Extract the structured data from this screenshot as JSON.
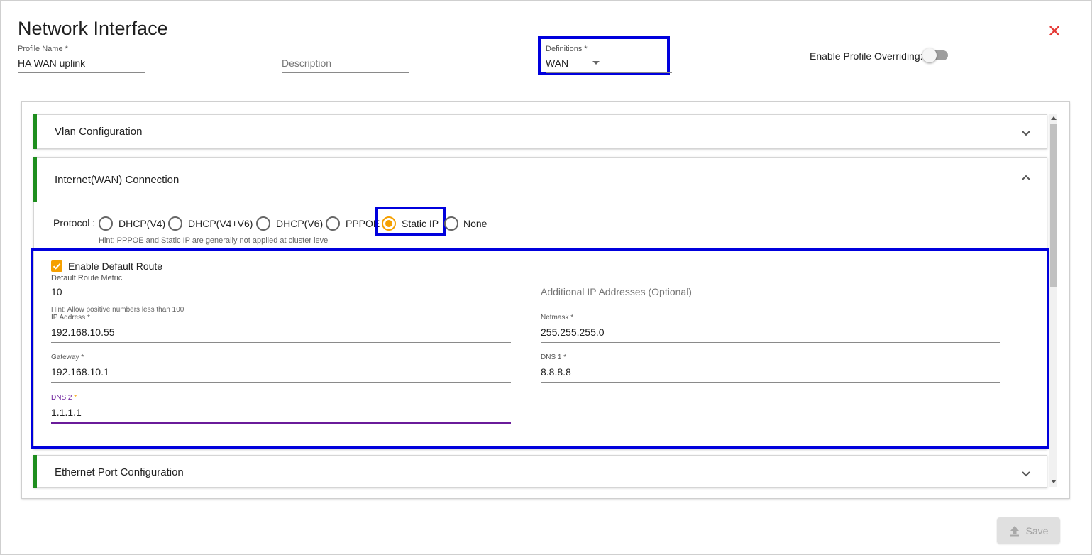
{
  "dialog": {
    "title": "Network Interface",
    "close_label": "✕"
  },
  "header": {
    "profile_name": {
      "label": "Profile Name *",
      "value": "HA WAN uplink"
    },
    "description": {
      "placeholder": "Description"
    },
    "definitions": {
      "label": "Definitions *",
      "value": "WAN"
    },
    "override": {
      "label": "Enable Profile Overriding:",
      "enabled": false
    }
  },
  "sections": {
    "vlan": {
      "title": "Vlan Configuration"
    },
    "wan": {
      "title": "Internet(WAN) Connection"
    },
    "ethernet": {
      "title": "Ethernet Port Configuration"
    }
  },
  "protocol": {
    "label": "Protocol :",
    "options": [
      "DHCP(V4)",
      "DHCP(V4+V6)",
      "DHCP(V6)",
      "PPPOE",
      "Static IP",
      "None"
    ],
    "selected": "Static IP",
    "hint": "Hint: PPPOE and Static IP are generally not applied at cluster level"
  },
  "static": {
    "default_route": {
      "label": "Enable Default Route",
      "checked": true
    },
    "metric": {
      "label": "Default Route Metric",
      "value": "10",
      "hint": "Hint: Allow positive numbers less than 100"
    },
    "additional_ip": {
      "placeholder": "Additional IP Addresses (Optional)"
    },
    "ip": {
      "label": "IP Address *",
      "value": "192.168.10.55"
    },
    "netmask": {
      "label": "Netmask *",
      "value": "255.255.255.0"
    },
    "gateway": {
      "label": "Gateway *",
      "value": "192.168.10.1"
    },
    "dns1": {
      "label": "DNS 1 *",
      "value": "8.8.8.8"
    },
    "dns2": {
      "label": "DNS 2",
      "required_mark": "*",
      "value": "1.1.1.1"
    }
  },
  "footer": {
    "save_label": "Save"
  },
  "colors": {
    "accent": "#f5a000",
    "section_bar": "#1e8e1e",
    "highlight": "#0000dd",
    "close": "#e53935",
    "focus": "#6a1b9a"
  }
}
